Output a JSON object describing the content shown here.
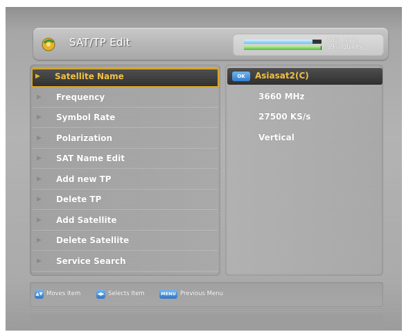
{
  "header": {
    "title": "SAT/TP Edit",
    "icon": "satellite-dish-icon",
    "signal": {
      "level_text": "88% Level",
      "quality_text": "99% Quality",
      "level_percent": 88,
      "quality_percent": 99
    }
  },
  "menu": {
    "items": [
      {
        "label": "Satellite Name",
        "selected": true
      },
      {
        "label": "Frequency"
      },
      {
        "label": "Symbol Rate"
      },
      {
        "label": "Polarization"
      },
      {
        "label": "SAT Name Edit"
      },
      {
        "label": "Add new TP"
      },
      {
        "label": "Delete TP"
      },
      {
        "label": "Add Satellite"
      },
      {
        "label": "Delete Satellite"
      },
      {
        "label": "Service Search"
      }
    ]
  },
  "values": {
    "ok_badge": "OK",
    "satellite_name": "Asiasat2(C)",
    "frequency": "3660 MHz",
    "symbol_rate": "27500 KS/s",
    "polarization": "Vertical"
  },
  "footer": {
    "move_key": "▲▼",
    "move_text": "Moves Item",
    "select_key": "◀▶",
    "select_text": "Selects Item",
    "menu_key": "MENU",
    "menu_text": "Previous Menu"
  },
  "colors": {
    "highlight": "#f0c040",
    "selection_border": "#d8a520",
    "key_blue": "#2f7ccc",
    "level_bar": "#6cc0ea",
    "quality_bar": "#55b93b"
  }
}
